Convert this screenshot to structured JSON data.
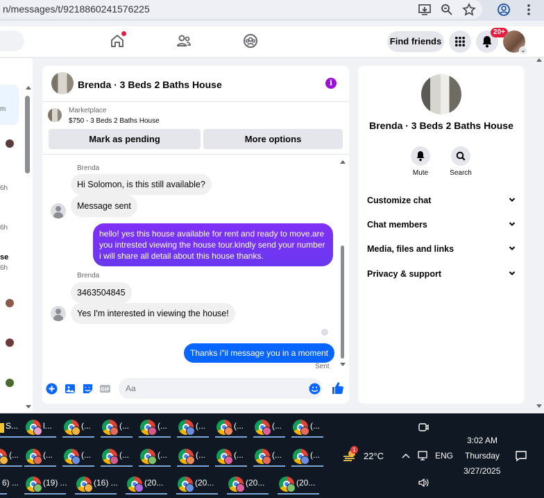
{
  "browser": {
    "url": "n/messages/t/9218860241576225"
  },
  "nav": {
    "find_friends": "Find friends",
    "notif_badge": "20+"
  },
  "left_list": {
    "snippets": [
      "m",
      "6h",
      "6h",
      "se",
      "6h"
    ]
  },
  "chat": {
    "title": "Brenda · 3 Beds 2 Baths House",
    "marketplace_label": "Marketplace",
    "listing": "$750 - 3 Beds 2 Baths House",
    "mark_pending": "Mark as pending",
    "more_options": "More options",
    "messages": {
      "sender1": "Brenda",
      "m1": "Hi Solomon, is this still available?",
      "m2": "Message sent",
      "m3": "hello! yes this house available for rent and ready to move.are you intrested viewing the house tour.kindly send your number i will share all detail about this house thanks.",
      "sender2": "Brenda",
      "m4": "3463504845",
      "m5": "Yes I'm interested in viewing the house!",
      "m6": "Thanks i\"il message you in a moment",
      "sent_status": "Sent"
    },
    "composer_placeholder": "Aa"
  },
  "info_panel": {
    "title": "Brenda · 3 Beds 2 Baths House",
    "mute": "Mute",
    "search": "Search",
    "rows": [
      "Customize chat",
      "Chat members",
      "Media, files and links",
      "Privacy & support"
    ]
  },
  "taskbar": {
    "row1": [
      "S...",
      "(...",
      "(...",
      "(...",
      "(...",
      "(...",
      "(...",
      "(..."
    ],
    "row1_first_extra": "l...",
    "row2": [
      "(...",
      "(...",
      "(...",
      "(...",
      "(...",
      "(...",
      "(...",
      "(..."
    ],
    "row3": [
      "6) ...",
      "(19) ...",
      "(16) ...",
      "(20...",
      "(20...",
      "(20...",
      "(20..."
    ],
    "weather": "22°C",
    "weather_badge": "1",
    "lang": "ENG",
    "time": "3:02 AM",
    "day": "Thursday",
    "date": "3/27/2025"
  }
}
